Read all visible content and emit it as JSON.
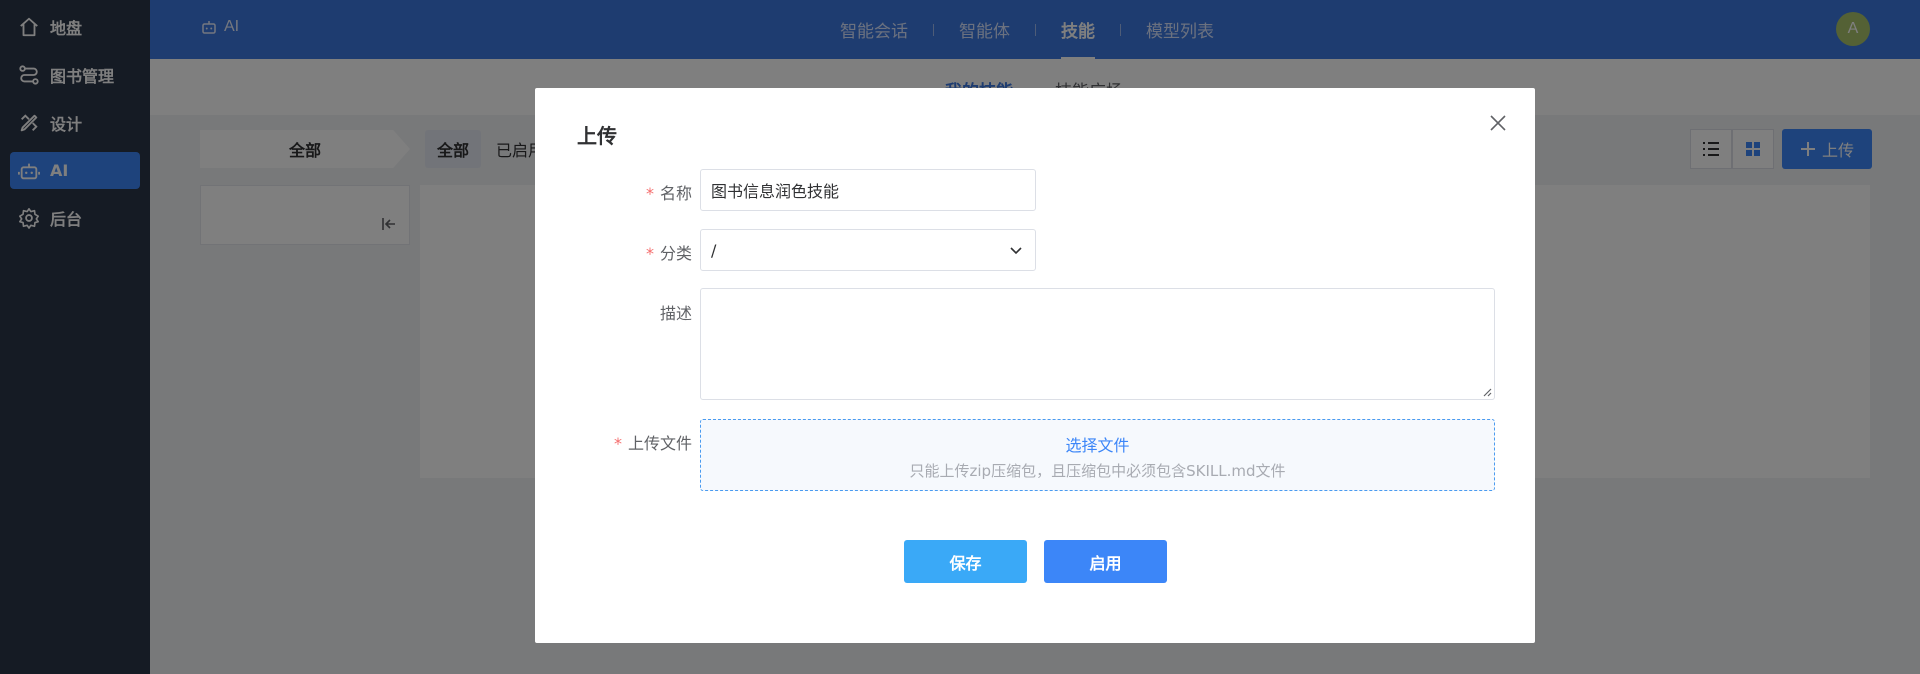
{
  "sidebar": {
    "items": [
      {
        "label": "地盘",
        "icon": "home-icon"
      },
      {
        "label": "图书管理",
        "icon": "workflow-icon"
      },
      {
        "label": "设计",
        "icon": "design-tools-icon"
      },
      {
        "label": "AI",
        "icon": "robot-icon",
        "active": true
      },
      {
        "label": "后台",
        "icon": "gear-icon"
      }
    ]
  },
  "header": {
    "brand": "AI",
    "nav": [
      "智能会话",
      "智能体",
      "技能",
      "模型列表"
    ],
    "active_nav": "技能",
    "avatar_letter": "A"
  },
  "subtabs": [
    "我的技能",
    "技能广场"
  ],
  "filters": {
    "breadcrumb": "全部",
    "chips": [
      "全部",
      "已启用"
    ]
  },
  "toolbar": {
    "upload_label": "上传"
  },
  "dialog": {
    "title": "上传",
    "fields": {
      "name": {
        "label": "名称",
        "value": "图书信息润色技能",
        "required": true
      },
      "category": {
        "label": "分类",
        "value": "/",
        "required": true
      },
      "description": {
        "label": "描述",
        "value": "",
        "required": false
      },
      "file": {
        "label": "上传文件",
        "required": true,
        "link": "选择文件",
        "tip": "只能上传zip压缩包，且压缩包中必须包含SKILL.md文件"
      }
    },
    "buttons": {
      "save": "保存",
      "enable": "启用"
    }
  },
  "colors": {
    "sidebar_bg": "#2b3649",
    "header_bg": "#3d78e0",
    "primary": "#3c86f8",
    "save_button": "#3aa9f7",
    "required": "#f56c6c"
  }
}
